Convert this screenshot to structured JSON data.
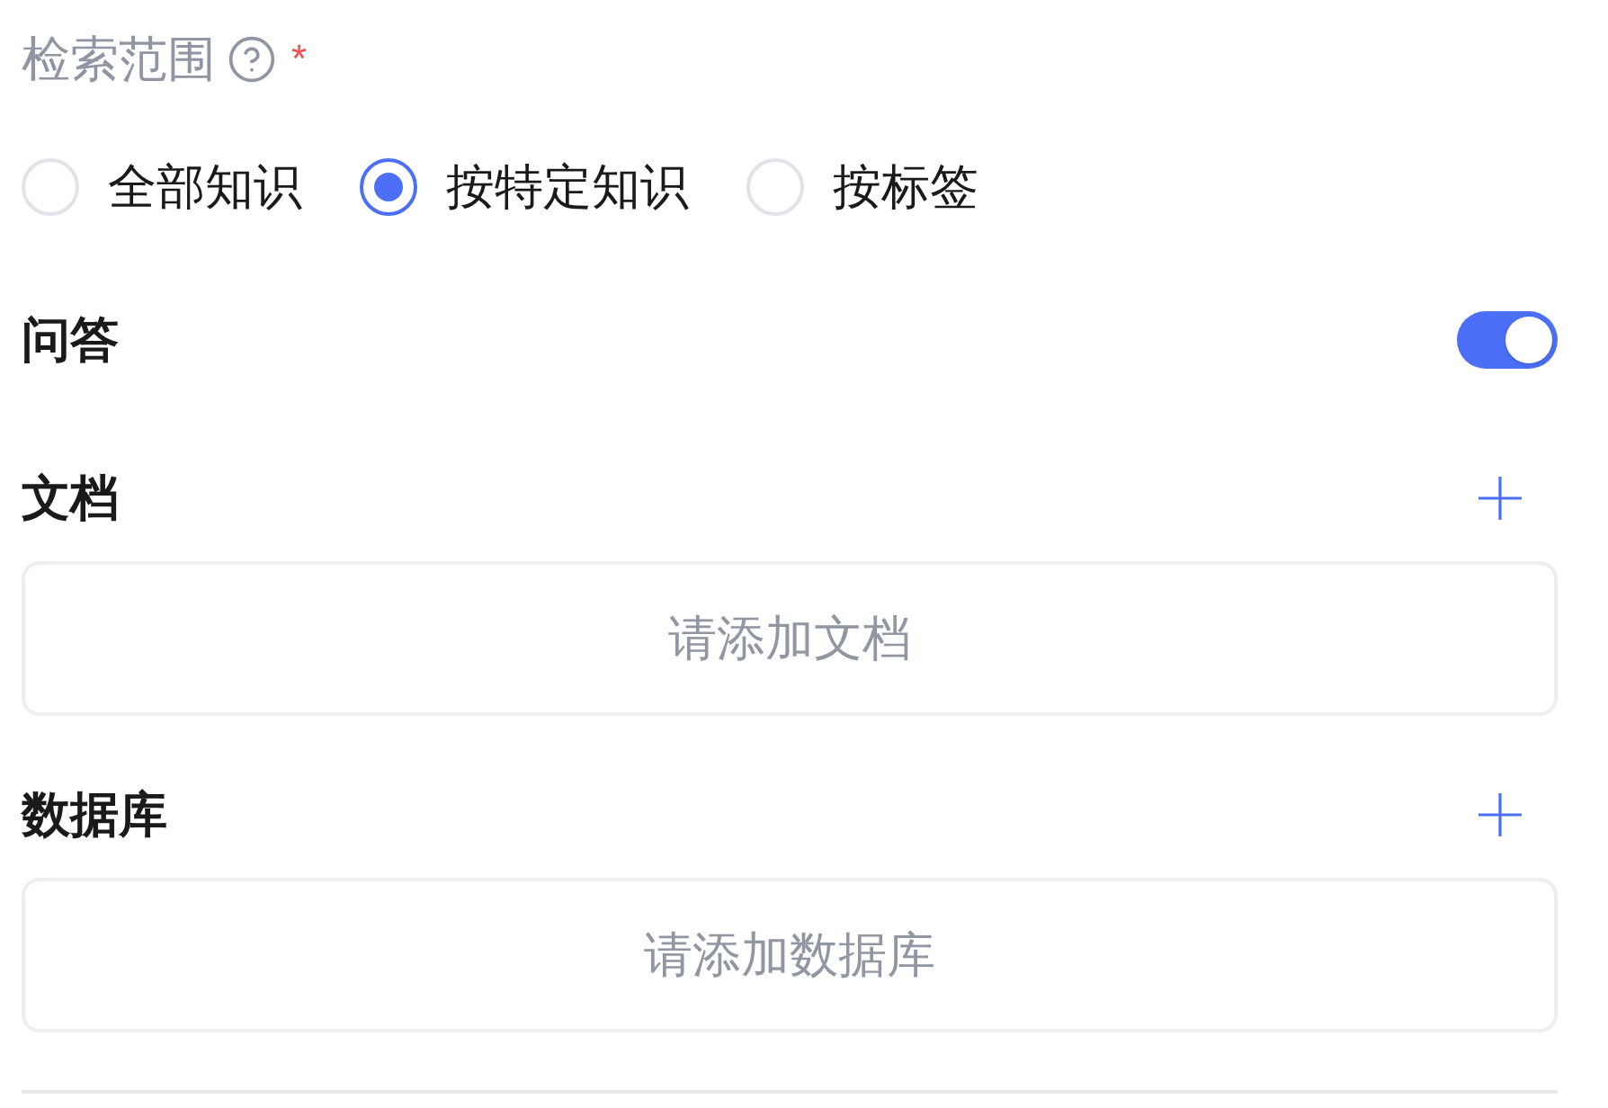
{
  "scope": {
    "label": "检索范围",
    "required_mark": "*",
    "options": [
      {
        "label": "全部知识",
        "selected": false
      },
      {
        "label": "按特定知识",
        "selected": true
      },
      {
        "label": "按标签",
        "selected": false
      }
    ]
  },
  "qa": {
    "label": "问答",
    "on": true
  },
  "sections": [
    {
      "title": "文档",
      "empty_hint": "请添加文档"
    },
    {
      "title": "数据库",
      "empty_hint": "请添加数据库"
    }
  ]
}
